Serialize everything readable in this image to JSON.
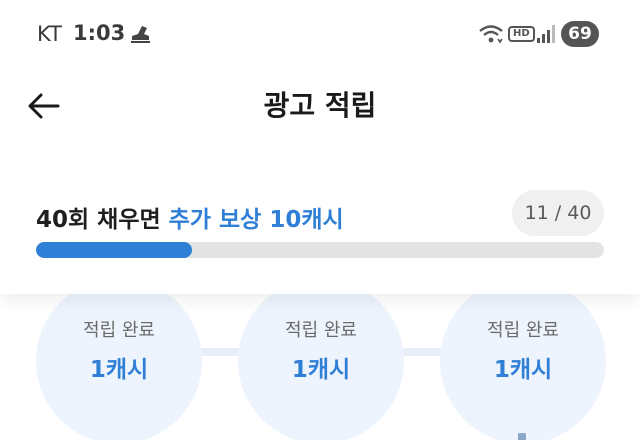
{
  "status_bar": {
    "carrier": "KT",
    "time": "1:03",
    "hd_label": "HD",
    "battery": "69",
    "icons": [
      "shoe-icon",
      "wifi-icon",
      "hd-voice-icon",
      "signal-icon",
      "battery-icon"
    ]
  },
  "header": {
    "back_icon": "arrow-left-icon",
    "title": "광고 적립"
  },
  "progress": {
    "text_prefix": "40회 채우면 ",
    "text_highlight": "추가 보상 10캐시",
    "count_label": "11 / 40",
    "current": 11,
    "total": 40,
    "fill_fraction": 0.275
  },
  "rewards": [
    {
      "status": "적립 완료",
      "amount": "1캐시"
    },
    {
      "status": "적립 완료",
      "amount": "1캐시"
    },
    {
      "status": "적립 완료",
      "amount": "1캐시"
    }
  ],
  "colors": {
    "accent": "#2f7fd6",
    "track": "#e4e4e4",
    "circle": "#eef4fd"
  }
}
